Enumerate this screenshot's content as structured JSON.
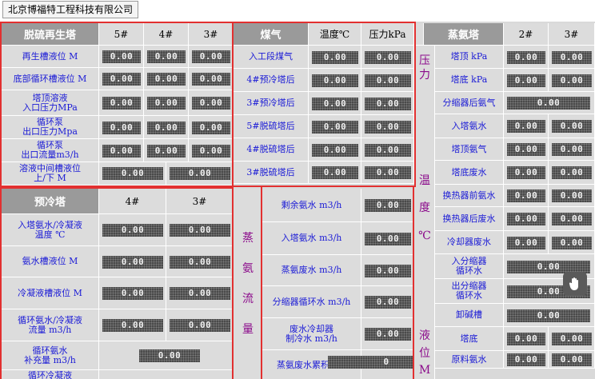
{
  "company": "北京博福特工程科技有限公司",
  "regen": {
    "title": "脱硫再生塔",
    "cols": [
      "5#",
      "4#",
      "3#"
    ],
    "rows": [
      {
        "label": "再生槽液位 M",
        "values": [
          "0.00",
          "0.00",
          "0.00"
        ]
      },
      {
        "label": "底部循环槽液位 M",
        "values": [
          "0.00",
          "0.00",
          "0.00"
        ]
      },
      {
        "label": "塔顶溶液\n入口压力MPa",
        "values": [
          "0.00",
          "0.00",
          "0.00"
        ]
      },
      {
        "label": "循环泵\n出口压力Mpa",
        "values": [
          "0.00",
          "0.00",
          "0.00"
        ]
      },
      {
        "label": "循环泵\n出口流量m3/h",
        "values": [
          "0.00",
          "0.00",
          "0.00"
        ]
      }
    ],
    "mid_label": "溶液中间槽液位\n上/下 M",
    "mid_values": [
      "0.00",
      "0.00"
    ]
  },
  "precool": {
    "title": "预冷塔",
    "cols": [
      "4#",
      "3#"
    ],
    "rows": [
      {
        "label": "入塔氨水/冷凝液\n温度 ℃",
        "values": [
          "0.00",
          "0.00"
        ]
      },
      {
        "label": "氨水槽液位 M",
        "values": [
          "0.00",
          "0.00"
        ]
      },
      {
        "label": "冷凝液槽液位 M",
        "values": [
          "0.00",
          "0.00"
        ]
      },
      {
        "label": "循环氨水/冷凝液\n流量 m3/h",
        "values": [
          "0.00",
          "0.00"
        ]
      }
    ],
    "supplement_label": "循环氨水\n补充量 m3/h",
    "supplement_value": "0.00",
    "last_label": "循环冷凝液"
  },
  "gas": {
    "title": "煤气",
    "col_temp": "温度℃",
    "col_press": "压力kPa",
    "rows": [
      {
        "label": "入工段煤气",
        "temp": "0.00",
        "press": "0.00"
      },
      {
        "label": "4#预冷塔后",
        "temp": "0.00",
        "press": "0.00"
      },
      {
        "label": "3#预冷塔后",
        "temp": "0.00",
        "press": "0.00"
      },
      {
        "label": "5#脱硫塔后",
        "temp": "0.00",
        "press": "0.00"
      },
      {
        "label": "4#脱硫塔后",
        "temp": "0.00",
        "press": "0.00"
      },
      {
        "label": "3#脱硫塔后",
        "temp": "0.00",
        "press": "0.00"
      }
    ]
  },
  "ammonia_flow": {
    "side": [
      "蒸",
      "氨",
      "流",
      "量"
    ],
    "rows": [
      {
        "label": "剩余氨水 m3/h",
        "value": "0.00"
      },
      {
        "label": "入塔氨水 m3/h",
        "value": "0.00"
      },
      {
        "label": "蒸氨废水 m3/h",
        "value": "0.00"
      },
      {
        "label": "分缩器循环水 m3/h",
        "value": "0.00"
      },
      {
        "label": "废水冷却器\n制冷水 m3/h",
        "value": "0.00"
      }
    ],
    "total_label": "蒸氨废水累积 m3",
    "total_value": "0"
  },
  "still": {
    "title": "蒸氨塔",
    "cols": [
      "2#",
      "3#"
    ],
    "side_pressure": [
      "压",
      "力"
    ],
    "side_temp": [
      "温",
      "度",
      "℃"
    ],
    "side_level": [
      "液",
      "位",
      "M"
    ],
    "rows": [
      {
        "label": "塔顶 kPa",
        "values": [
          "0.00",
          "0.00"
        ]
      },
      {
        "label": "塔底 kPa",
        "values": [
          "0.00",
          "0.00"
        ]
      },
      {
        "label": "分缩器后氨气",
        "values": [
          "0.00"
        ]
      },
      {
        "label": "入塔氨水",
        "values": [
          "0.00",
          "0.00"
        ]
      },
      {
        "label": "塔顶氨气",
        "values": [
          "0.00",
          "0.00"
        ]
      },
      {
        "label": "塔底废水",
        "values": [
          "0.00",
          "0.00"
        ]
      },
      {
        "label": "换热器前氨水",
        "values": [
          "0.00",
          "0.00"
        ]
      },
      {
        "label": "换热器后废水",
        "values": [
          "0.00",
          "0.00"
        ]
      },
      {
        "label": "冷却器废水",
        "values": [
          "0.00",
          "0.00"
        ]
      },
      {
        "label": "入分缩器\n循环水",
        "values": [
          "0.00"
        ]
      },
      {
        "label": "出分缩器\n循环水",
        "values": [
          "0.00"
        ]
      },
      {
        "label": "卸碱槽",
        "values": [
          "0.00"
        ]
      },
      {
        "label": "塔底",
        "values": [
          "0.00",
          "0.00"
        ]
      },
      {
        "label": "原料氨水",
        "values": [
          "0.00",
          "0.00"
        ]
      }
    ]
  }
}
